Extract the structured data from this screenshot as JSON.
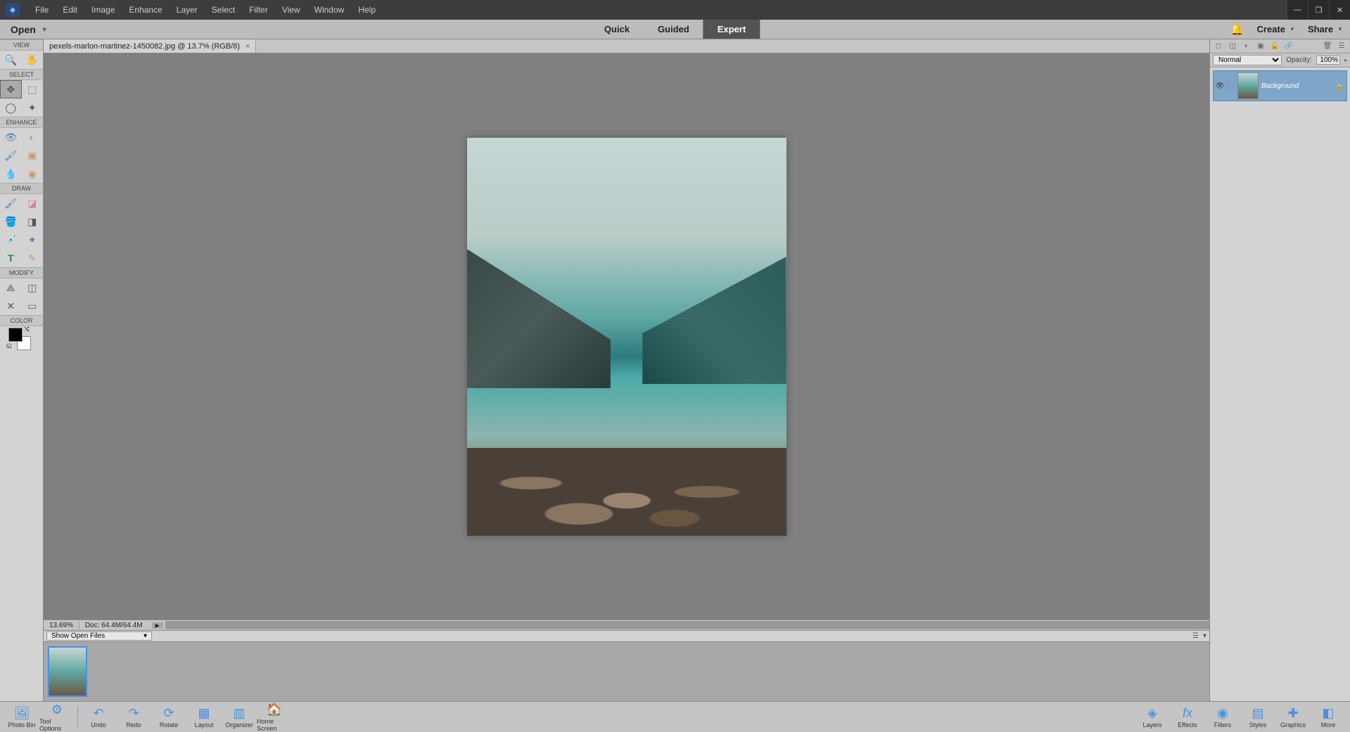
{
  "menubar": {
    "items": [
      "File",
      "Edit",
      "Image",
      "Enhance",
      "Layer",
      "Select",
      "Filter",
      "View",
      "Window",
      "Help"
    ]
  },
  "workspace": {
    "open_label": "Open",
    "tabs": [
      "Quick",
      "Guided",
      "Expert"
    ],
    "active_tab": "Expert",
    "create_label": "Create",
    "share_label": "Share"
  },
  "toolbox": {
    "sections": {
      "view": "VIEW",
      "select": "SELECT",
      "enhance": "ENHANCE",
      "draw": "DRAW",
      "modify": "MODIFY",
      "color": "COLOR"
    }
  },
  "document": {
    "tab_title": "pexels-marlon-martinez-1450082.jpg @ 13.7% (RGB/8)",
    "zoom": "13.69%",
    "doc_info": "Doc: 64.4M/64.4M"
  },
  "photo_bin": {
    "dropdown_label": "Show Open Files"
  },
  "layers_panel": {
    "blend_mode": "Normal",
    "opacity_label": "Opacity:",
    "opacity_value": "100%",
    "layer_name": "Background"
  },
  "bottom_bar": {
    "buttons": {
      "photo_bin": "Photo Bin",
      "tool_options": "Tool Options",
      "undo": "Undo",
      "redo": "Redo",
      "rotate": "Rotate",
      "layout": "Layout",
      "organizer": "Organizer",
      "home_screen": "Home Screen",
      "layers": "Layers",
      "effects": "Effects",
      "filters": "Filters",
      "styles": "Styles",
      "graphics": "Graphics",
      "more": "More"
    }
  }
}
